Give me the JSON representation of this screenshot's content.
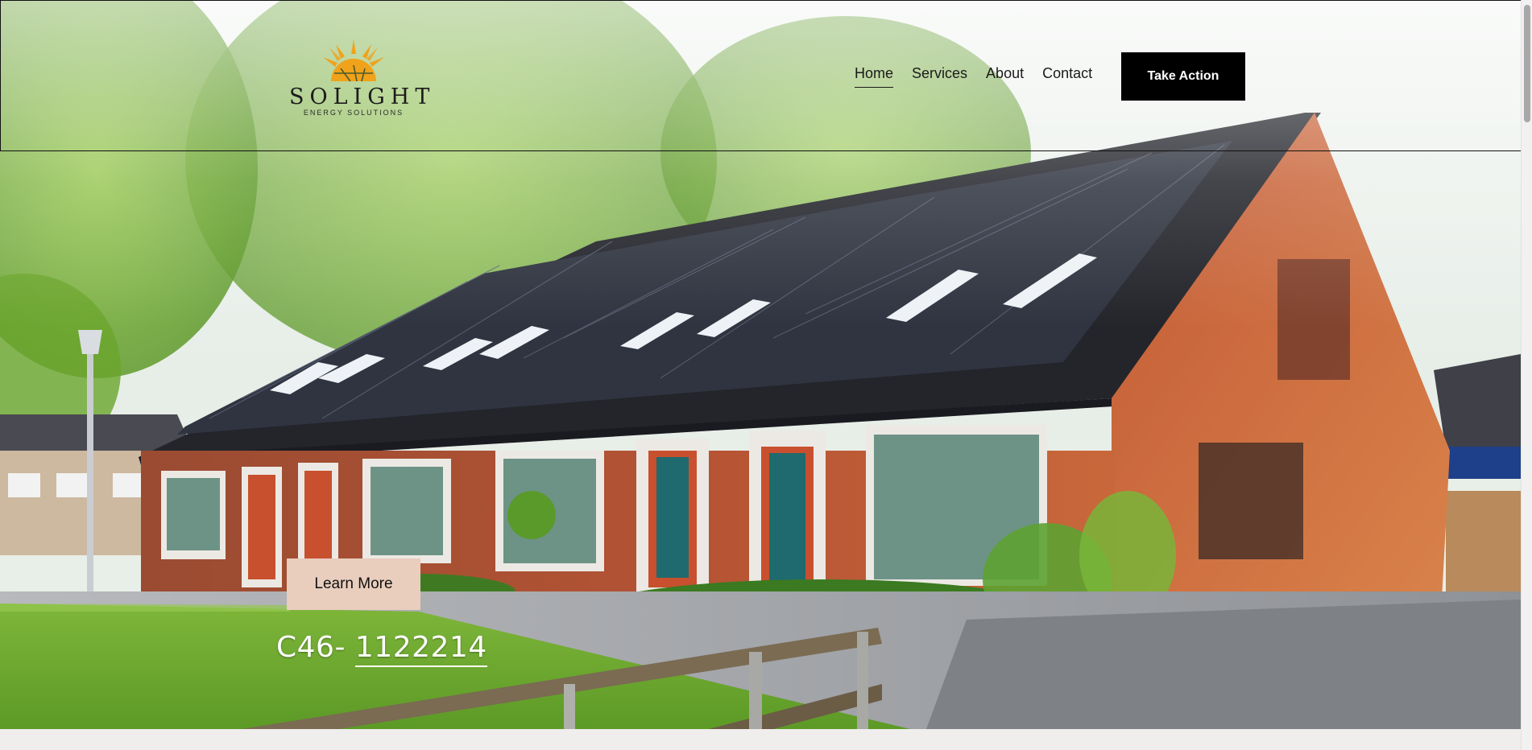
{
  "brand": {
    "name": "SOLIGHT",
    "tagline": "ENERGY SOLUTIONS",
    "sun_color": "#f0a21a"
  },
  "nav": {
    "items": [
      {
        "label": "Home",
        "active": true
      },
      {
        "label": "Services",
        "active": false
      },
      {
        "label": "About",
        "active": false
      },
      {
        "label": "Contact",
        "active": false
      }
    ],
    "cta_label": "Take Action"
  },
  "hero": {
    "image": "solar-panel-rowhouses-photo",
    "button_label": "Learn More",
    "license_prefix": "C46-",
    "license_number": "1122214",
    "button_color": "#e9cdbd"
  }
}
